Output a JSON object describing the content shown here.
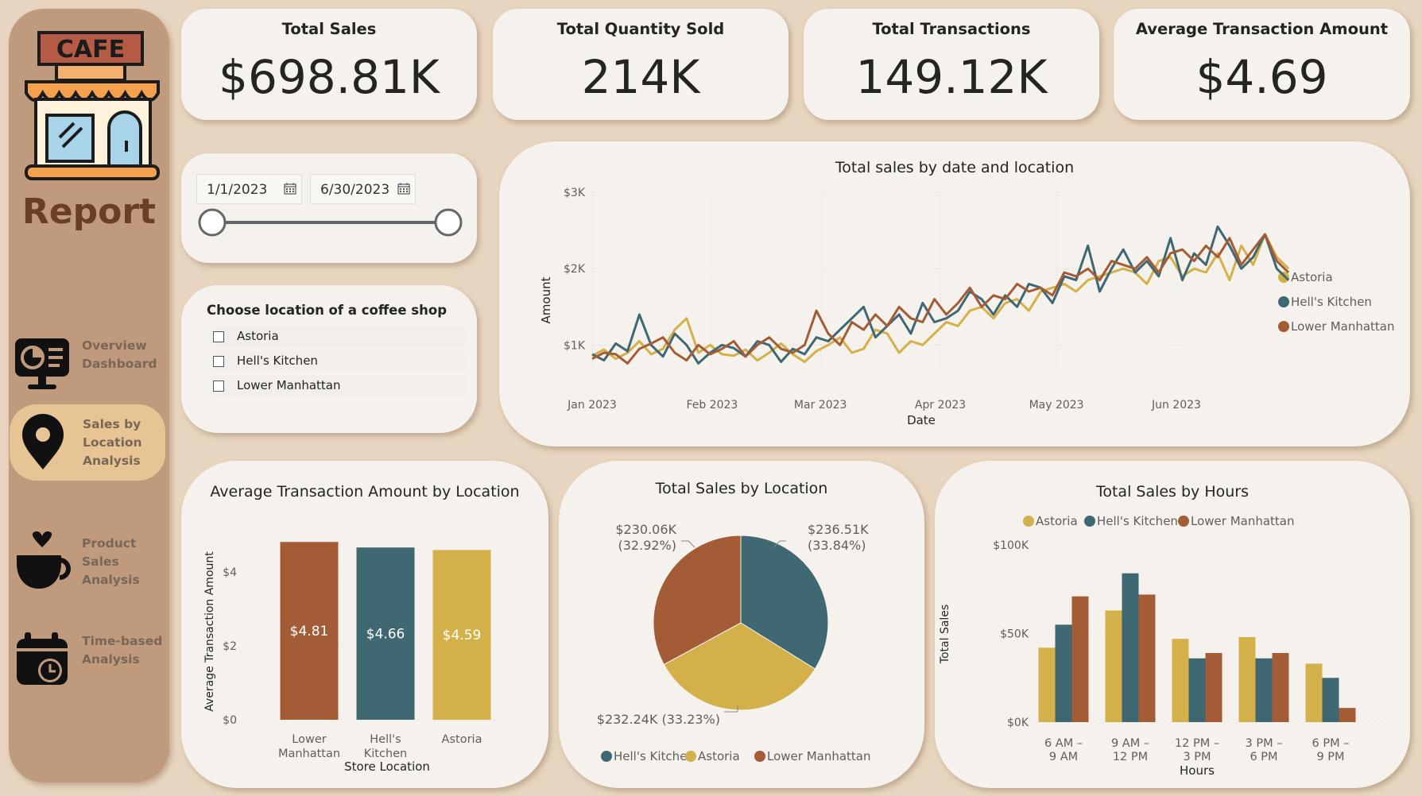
{
  "sidebar": {
    "logo_text": "CAFE",
    "title": "Report",
    "nav": [
      {
        "label": "Overview Dashboard",
        "icon": "dashboard-icon"
      },
      {
        "label": "Sales by Location Analysis",
        "icon": "location-pin-icon",
        "active": true
      },
      {
        "label": "Product Sales Analysis",
        "icon": "coffee-cup-icon"
      },
      {
        "label": "Time-based Analysis",
        "icon": "calendar-clock-icon"
      }
    ]
  },
  "kpis": [
    {
      "title": "Total Sales",
      "value": "$698.81K"
    },
    {
      "title": "Total Quantity Sold",
      "value": "214K"
    },
    {
      "title": "Total Transactions",
      "value": "149.12K"
    },
    {
      "title": "Average Transaction Amount",
      "value": "$4.69"
    }
  ],
  "date_slicer": {
    "start": "1/1/2023",
    "end": "6/30/2023"
  },
  "location_slicer": {
    "title": "Choose location of a coffee shop",
    "options": [
      "Astoria",
      "Hell's Kitchen",
      "Lower Manhattan"
    ]
  },
  "colors": {
    "astoria": "#d4b04a",
    "hells_kitchen": "#406873",
    "lower_manhattan": "#a35c36"
  },
  "chart_data": [
    {
      "type": "line",
      "title": "Total sales by date and location",
      "xlabel": "Date",
      "ylabel": "Amount",
      "yticks": [
        "$1K",
        "$2K",
        "$3K"
      ],
      "ylim": [
        650,
        3000
      ],
      "xticks": [
        "Jan 2023",
        "Feb 2023",
        "Mar 2023",
        "Apr 2023",
        "May 2023",
        "Jun 2023"
      ],
      "x_range": [
        "2023-01-01",
        "2023-06-30"
      ],
      "legend": "right",
      "series": [
        {
          "name": "Astoria",
          "color": "#d4b04a",
          "values": [
            860,
            940,
            820,
            900,
            1050,
            880,
            950,
            1200,
            1350,
            900,
            1000,
            880,
            860,
            940,
            800,
            900,
            1020,
            880,
            780,
            920,
            1000,
            1100,
            900,
            950,
            1200,
            1150,
            900,
            1050,
            1000,
            1150,
            1300,
            1250,
            1450,
            1500,
            1350,
            1550,
            1600,
            1450,
            1700,
            1750,
            1800,
            1700,
            1850,
            1900,
            1950,
            2000,
            1950,
            1800,
            2100,
            2150,
            1900,
            2000,
            1950,
            2200,
            1850,
            2300,
            2050,
            2450,
            2150,
            2000
          ]
        },
        {
          "name": "Hell's Kitchen",
          "color": "#406873",
          "values": [
            880,
            800,
            1020,
            920,
            1400,
            1000,
            850,
            1150,
            1000,
            760,
            900,
            1000,
            960,
            850,
            1050,
            1000,
            780,
            950,
            880,
            1100,
            1050,
            1200,
            1350,
            1500,
            1100,
            1250,
            1400,
            1150,
            1550,
            1300,
            1350,
            1450,
            1700,
            1600,
            1400,
            1650,
            1500,
            1800,
            1750,
            1550,
            1900,
            1850,
            2300,
            1700,
            2000,
            2250,
            1950,
            2100,
            1900,
            2400,
            1850,
            2200,
            2050,
            2550,
            2300,
            2000,
            2150,
            2450,
            2000,
            1850
          ]
        },
        {
          "name": "Lower Manhattan",
          "color": "#a35c36",
          "values": [
            820,
            900,
            880,
            760,
            950,
            1020,
            1100,
            900,
            800,
            1000,
            880,
            950,
            1050,
            850,
            1000,
            1100,
            950,
            900,
            1000,
            1450,
            1150,
            1000,
            1300,
            1200,
            1400,
            1250,
            1500,
            1350,
            1300,
            1600,
            1400,
            1550,
            1750,
            1500,
            1650,
            1600,
            1800,
            1700,
            1750,
            1650,
            1950,
            1900,
            2000,
            1850,
            2100,
            2050,
            2000,
            2150,
            1950,
            2200,
            2250,
            2100,
            2300,
            2150,
            2400,
            2050,
            2250,
            2450,
            2100,
            1950
          ]
        }
      ]
    },
    {
      "type": "bar",
      "title": "Average Transaction Amount by Location",
      "xlabel": "Store Location",
      "ylabel": "Average Transaction Amount",
      "categories": [
        "Lower Manhattan",
        "Hell's Kitchen",
        "Astoria"
      ],
      "values": [
        4.81,
        4.66,
        4.59
      ],
      "data_labels": [
        "$4.81",
        "$4.66",
        "$4.59"
      ],
      "yticks": [
        "$0",
        "$2",
        "$4"
      ],
      "ylim": [
        0,
        4.9
      ],
      "colors": [
        "#a35c36",
        "#406873",
        "#d4b04a"
      ]
    },
    {
      "type": "pie",
      "title": "Total Sales by Location",
      "slices": [
        {
          "name": "Hell's Kitchen",
          "value": 236.51,
          "label": "$236.51K",
          "pct": "(33.84%)",
          "color": "#406873"
        },
        {
          "name": "Astoria",
          "value": 232.24,
          "label": "$232.24K (33.23%)",
          "color": "#d4b04a"
        },
        {
          "name": "Lower Manhattan",
          "value": 230.06,
          "label": "$230.06K",
          "pct": "(32.92%)",
          "color": "#a35c36"
        }
      ],
      "legend": "bottom"
    },
    {
      "type": "bar",
      "title": "Total Sales by Hours",
      "xlabel": "Hours",
      "ylabel": "Total Sales",
      "categories": [
        "6 AM – 9 AM",
        "9 AM – 12 PM",
        "12 PM – 3 PM",
        "3 PM – 6 PM",
        "6 PM – 9 PM"
      ],
      "yticks": [
        "$0K",
        "$50K",
        "$100K"
      ],
      "ylim": [
        0,
        100000
      ],
      "legend": "top",
      "series": [
        {
          "name": "Astoria",
          "color": "#d4b04a",
          "values": [
            42000,
            63000,
            47000,
            48000,
            33000
          ]
        },
        {
          "name": "Hell's Kitchen",
          "color": "#406873",
          "values": [
            55000,
            84000,
            36000,
            36000,
            25000
          ]
        },
        {
          "name": "Lower Manhattan",
          "color": "#a35c36",
          "values": [
            71000,
            72000,
            39000,
            39000,
            8000
          ]
        }
      ]
    }
  ]
}
